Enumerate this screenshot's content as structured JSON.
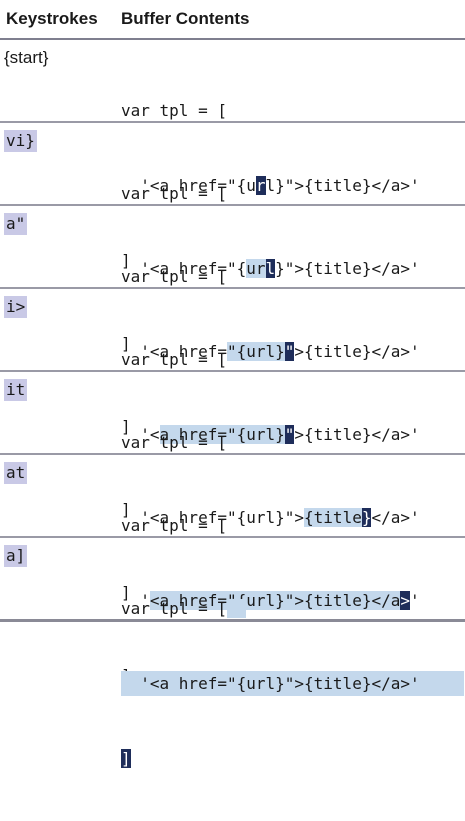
{
  "header": {
    "keystrokes": "Keystrokes",
    "buffer": "Buffer Contents"
  },
  "rows": [
    {
      "keys": "{start}",
      "line1": "var tpl = [",
      "line2": {
        "pre": "  '<a href=\"{u",
        "sel": "",
        "cur": "r",
        "post": "l}\">{title}</a>'"
      },
      "line3": "]"
    },
    {
      "keys": "vi}",
      "line1": "var tpl = [",
      "line2": {
        "pre": "  '<a href=\"{",
        "sel": "ur",
        "cur": "l",
        "post": "}\">{title}</a>'"
      },
      "line3": "]"
    },
    {
      "keys": "a\"",
      "line1": "var tpl = [",
      "line2": {
        "pre": "  '<a href=",
        "sel": "\"{url}",
        "cur": "\"",
        "post": ">{title}</a>'"
      },
      "line3": "]"
    },
    {
      "keys": "i>",
      "line1": "var tpl = [",
      "line2": {
        "pre": "  '<",
        "sel": "a href=\"{url}",
        "cur": "\"",
        "post": ">{title}</a>'"
      },
      "line3": "]"
    },
    {
      "keys": "it",
      "line1": "var tpl = [",
      "line2": {
        "pre": "  '<a href=\"{url}\">",
        "sel": "{title",
        "cur": "}",
        "post": "</a>'"
      },
      "line3": "]"
    },
    {
      "keys": "at",
      "line1": "var tpl = [",
      "line2": {
        "pre": "  '",
        "sel": "<a href=\"{url}\">{title}</a",
        "cur": ">",
        "post": "'"
      },
      "line3": "]"
    },
    {
      "keys": "a]",
      "line1": "var tpl = [",
      "line2": {
        "pre": "",
        "sel": "  '<a href=\"{url}\">{title}</a>' ",
        "cur": "",
        "post": ""
      },
      "line3": "]"
    }
  ]
}
